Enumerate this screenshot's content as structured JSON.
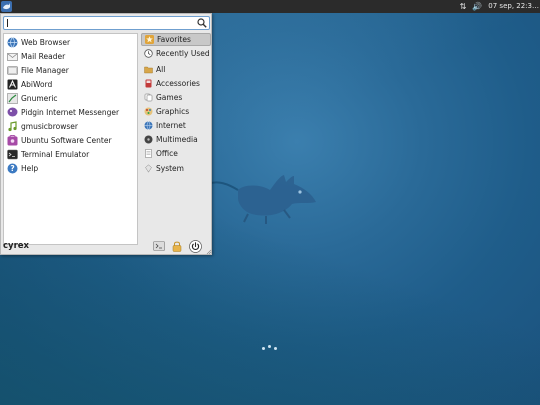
{
  "topbar": {
    "clock": "07 sep, 22:3…",
    "network_icon": "network-updown-icon",
    "volume_icon": "volume-icon"
  },
  "menu": {
    "search": {
      "value": "",
      "placeholder": ""
    },
    "apps": [
      {
        "label": "Web Browser",
        "icon": "web-browser-icon"
      },
      {
        "label": "Mail Reader",
        "icon": "mail-reader-icon"
      },
      {
        "label": "File Manager",
        "icon": "file-manager-icon"
      },
      {
        "label": "AbiWord",
        "icon": "abiword-icon"
      },
      {
        "label": "Gnumeric",
        "icon": "gnumeric-icon"
      },
      {
        "label": "Pidgin Internet Messenger",
        "icon": "pidgin-icon"
      },
      {
        "label": "gmusicbrowser",
        "icon": "gmusicbrowser-icon"
      },
      {
        "label": "Ubuntu Software Center",
        "icon": "software-center-icon"
      },
      {
        "label": "Terminal Emulator",
        "icon": "terminal-icon"
      },
      {
        "label": "Help",
        "icon": "help-icon"
      }
    ],
    "categories": [
      {
        "label": "Favorites",
        "icon": "star-icon",
        "active": true
      },
      {
        "label": "Recently Used",
        "icon": "clock-icon"
      },
      {
        "label": "All",
        "icon": "folder-icon"
      },
      {
        "label": "Accessories",
        "icon": "accessories-icon"
      },
      {
        "label": "Games",
        "icon": "games-icon"
      },
      {
        "label": "Graphics",
        "icon": "graphics-icon"
      },
      {
        "label": "Internet",
        "icon": "internet-icon"
      },
      {
        "label": "Multimedia",
        "icon": "multimedia-icon"
      },
      {
        "label": "Office",
        "icon": "office-icon"
      },
      {
        "label": "System",
        "icon": "system-icon"
      }
    ],
    "username": "cyrex"
  },
  "colors": {
    "panel": "#2b2b2b",
    "menu_bg": "#e8e8e8",
    "selected_category": "#c8c8c8",
    "desktop": "#1f5d8a"
  }
}
